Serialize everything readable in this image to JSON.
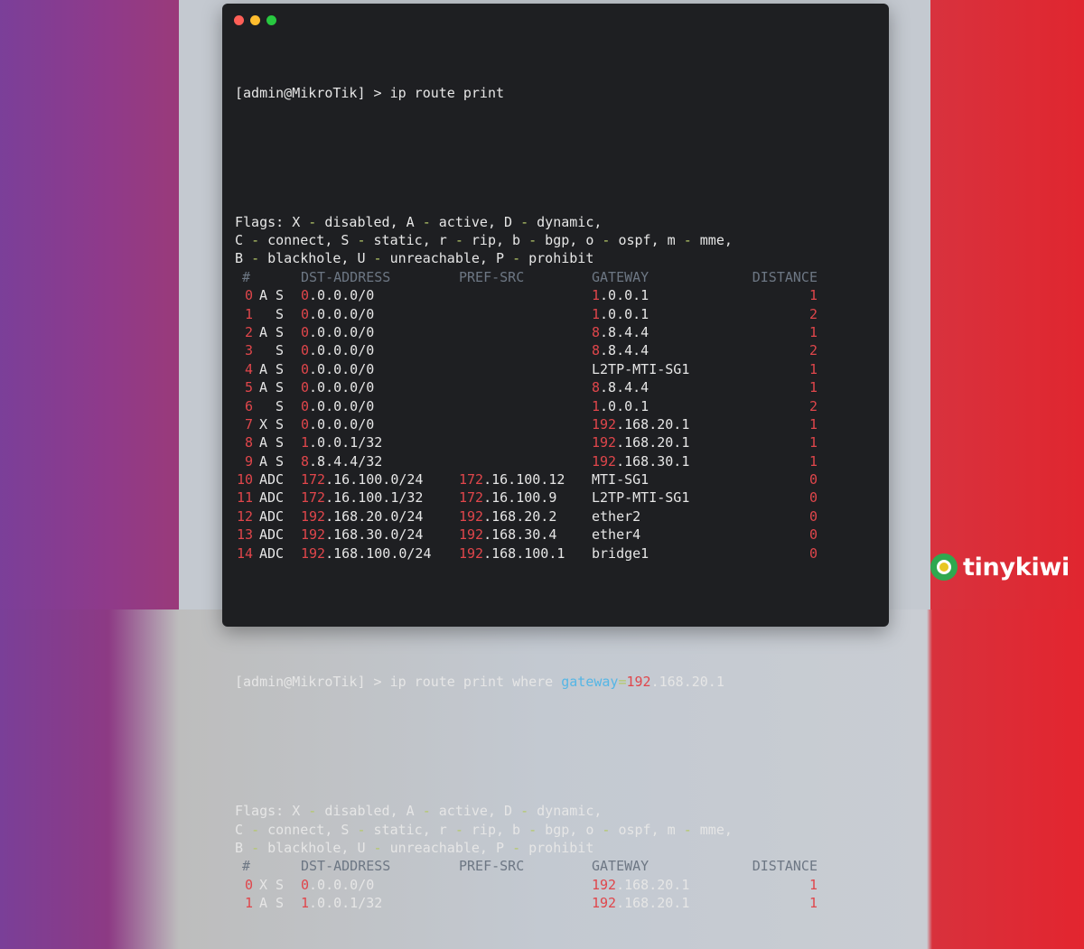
{
  "terminal": {
    "prompt": "[admin@MikroTik] >",
    "command1": "ip route print",
    "command2_prefix": "ip route print where ",
    "command2_key": "gateway",
    "command2_eq": "=",
    "command2_val_a": "192",
    "command2_val_b": ".168.20.1",
    "flags_line1": [
      "Flags: X ",
      "-",
      " disabled, A ",
      "-",
      " active, D ",
      "-",
      " dynamic,"
    ],
    "flags_line2": [
      "C ",
      "-",
      " connect, S ",
      "-",
      " static, r ",
      "-",
      " rip, b ",
      "-",
      " bgp, o ",
      "-",
      " ospf, m ",
      "-",
      " mme,"
    ],
    "flags_line3": [
      "B ",
      "-",
      " blackhole, U ",
      "-",
      " unreachable, P ",
      "-",
      " prohibit"
    ],
    "headers": {
      "num": "#",
      "dst": "DST-ADDRESS",
      "pref": "PREF-SRC",
      "gw": "GATEWAY",
      "dist": "DISTANCE"
    },
    "routes1": [
      {
        "num": "0",
        "flags": "A S",
        "dst_a": "0",
        "dst_b": ".0.0.0/0",
        "pref_a": "",
        "pref_b": "",
        "gw_a": "1",
        "gw_b": ".0.0.1",
        "dist": "1"
      },
      {
        "num": "1",
        "flags": "  S",
        "dst_a": "0",
        "dst_b": ".0.0.0/0",
        "pref_a": "",
        "pref_b": "",
        "gw_a": "1",
        "gw_b": ".0.0.1",
        "dist": "2"
      },
      {
        "num": "2",
        "flags": "A S",
        "dst_a": "0",
        "dst_b": ".0.0.0/0",
        "pref_a": "",
        "pref_b": "",
        "gw_a": "8",
        "gw_b": ".8.4.4",
        "dist": "1"
      },
      {
        "num": "3",
        "flags": "  S",
        "dst_a": "0",
        "dst_b": ".0.0.0/0",
        "pref_a": "",
        "pref_b": "",
        "gw_a": "8",
        "gw_b": ".8.4.4",
        "dist": "2"
      },
      {
        "num": "4",
        "flags": "A S",
        "dst_a": "0",
        "dst_b": ".0.0.0/0",
        "pref_a": "",
        "pref_b": "",
        "gw_a": "",
        "gw_b": "L2TP-MTI-SG1",
        "dist": "1"
      },
      {
        "num": "5",
        "flags": "A S",
        "dst_a": "0",
        "dst_b": ".0.0.0/0",
        "pref_a": "",
        "pref_b": "",
        "gw_a": "8",
        "gw_b": ".8.4.4",
        "dist": "1"
      },
      {
        "num": "6",
        "flags": "  S",
        "dst_a": "0",
        "dst_b": ".0.0.0/0",
        "pref_a": "",
        "pref_b": "",
        "gw_a": "1",
        "gw_b": ".0.0.1",
        "dist": "2"
      },
      {
        "num": "7",
        "flags": "X S",
        "dst_a": "0",
        "dst_b": ".0.0.0/0",
        "pref_a": "",
        "pref_b": "",
        "gw_a": "192",
        "gw_b": ".168.20.1",
        "dist": "1"
      },
      {
        "num": "8",
        "flags": "A S",
        "dst_a": "1",
        "dst_b": ".0.0.1/32",
        "pref_a": "",
        "pref_b": "",
        "gw_a": "192",
        "gw_b": ".168.20.1",
        "dist": "1"
      },
      {
        "num": "9",
        "flags": "A S",
        "dst_a": "8",
        "dst_b": ".8.4.4/32",
        "pref_a": "",
        "pref_b": "",
        "gw_a": "192",
        "gw_b": ".168.30.1",
        "dist": "1"
      },
      {
        "num": "10",
        "flags": "ADC",
        "dst_a": "172",
        "dst_b": ".16.100.0/24",
        "pref_a": "172",
        "pref_b": ".16.100.12",
        "gw_a": "",
        "gw_b": "MTI-SG1",
        "dist": "0"
      },
      {
        "num": "11",
        "flags": "ADC",
        "dst_a": "172",
        "dst_b": ".16.100.1/32",
        "pref_a": "172",
        "pref_b": ".16.100.9",
        "gw_a": "",
        "gw_b": "L2TP-MTI-SG1",
        "dist": "0"
      },
      {
        "num": "12",
        "flags": "ADC",
        "dst_a": "192",
        "dst_b": ".168.20.0/24",
        "pref_a": "192",
        "pref_b": ".168.20.2",
        "gw_a": "",
        "gw_b": "ether2",
        "dist": "0"
      },
      {
        "num": "13",
        "flags": "ADC",
        "dst_a": "192",
        "dst_b": ".168.30.0/24",
        "pref_a": "192",
        "pref_b": ".168.30.4",
        "gw_a": "",
        "gw_b": "ether4",
        "dist": "0"
      },
      {
        "num": "14",
        "flags": "ADC",
        "dst_a": "192",
        "dst_b": ".168.100.0/24",
        "pref_a": "192",
        "pref_b": ".168.100.1",
        "gw_a": "",
        "gw_b": "bridge1",
        "dist": "0"
      }
    ],
    "routes2": [
      {
        "num": "0",
        "flags": "X S",
        "dst_a": "0",
        "dst_b": ".0.0.0/0",
        "pref_a": "",
        "pref_b": "",
        "gw_a": "192",
        "gw_b": ".168.20.1",
        "dist": "1"
      },
      {
        "num": "1",
        "flags": "A S",
        "dst_a": "1",
        "dst_b": ".0.0.1/32",
        "pref_a": "",
        "pref_b": "",
        "gw_a": "192",
        "gw_b": ".168.20.1",
        "dist": "1"
      }
    ]
  },
  "brand": {
    "name": "tinykiwi"
  },
  "colors": {
    "accent_red": "#e0464b",
    "accent_green": "#b5c96a",
    "accent_cyan": "#55b6e5",
    "header_gray": "#6d7784"
  }
}
